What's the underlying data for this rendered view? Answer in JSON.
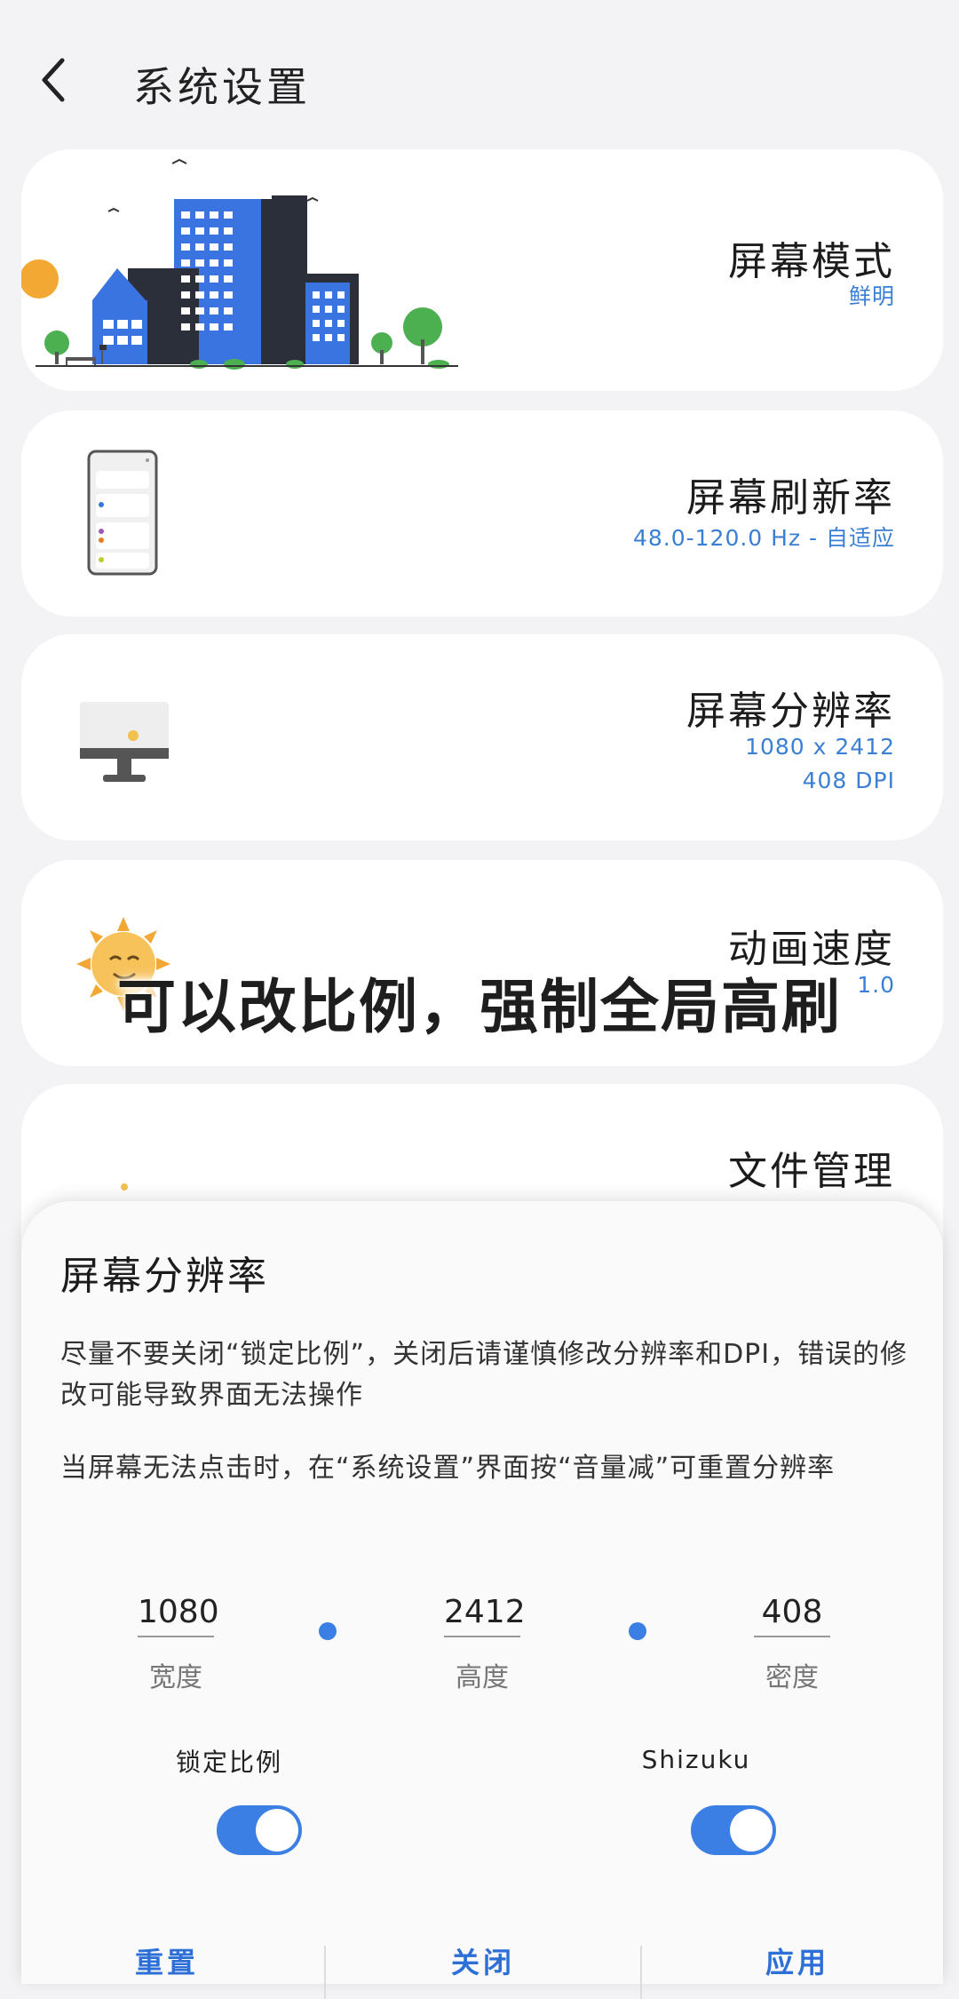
{
  "header": {
    "title": "系统设置",
    "back_icon": "chevron-left-icon"
  },
  "cards": {
    "screen_mode": {
      "title": "屏幕模式",
      "subtitle": "鲜明"
    },
    "refresh_rate": {
      "title": "屏幕刷新率",
      "subtitle": "48.0-120.0 Hz - 自适应"
    },
    "resolution": {
      "title": "屏幕分辨率",
      "subtitle_line1": "1080 x 2412",
      "subtitle_line2": "408 DPI"
    },
    "animation_speed": {
      "title": "动画速度",
      "subtitle": "1.0"
    },
    "file_manager": {
      "title": "文件管理"
    }
  },
  "overlay_caption": "可以改比例，强制全局高刷",
  "dialog": {
    "title": "屏幕分辨率",
    "paragraph1": "尽量不要关闭“锁定比例”，关闭后请谨慎修改分辨率和DPI，错误的修改可能导致界面无法操作",
    "paragraph2": "当屏幕无法点击时，在“系统设置”界面按“音量减”可重置分辨率",
    "width": {
      "value": "1080",
      "label": "宽度"
    },
    "height": {
      "value": "2412",
      "label": "高度"
    },
    "density": {
      "value": "408",
      "label": "密度"
    },
    "lock_ratio": {
      "label": "锁定比例",
      "on": true
    },
    "shizuku": {
      "label": "Shizuku",
      "on": true
    },
    "buttons": {
      "reset": "重置",
      "close": "关闭",
      "apply": "应用"
    }
  },
  "colors": {
    "accent": "#3b7fe5",
    "subtitle_blue": "#3b7fd4",
    "card_bg": "#ffffff",
    "page_bg": "#f3f3f5"
  }
}
